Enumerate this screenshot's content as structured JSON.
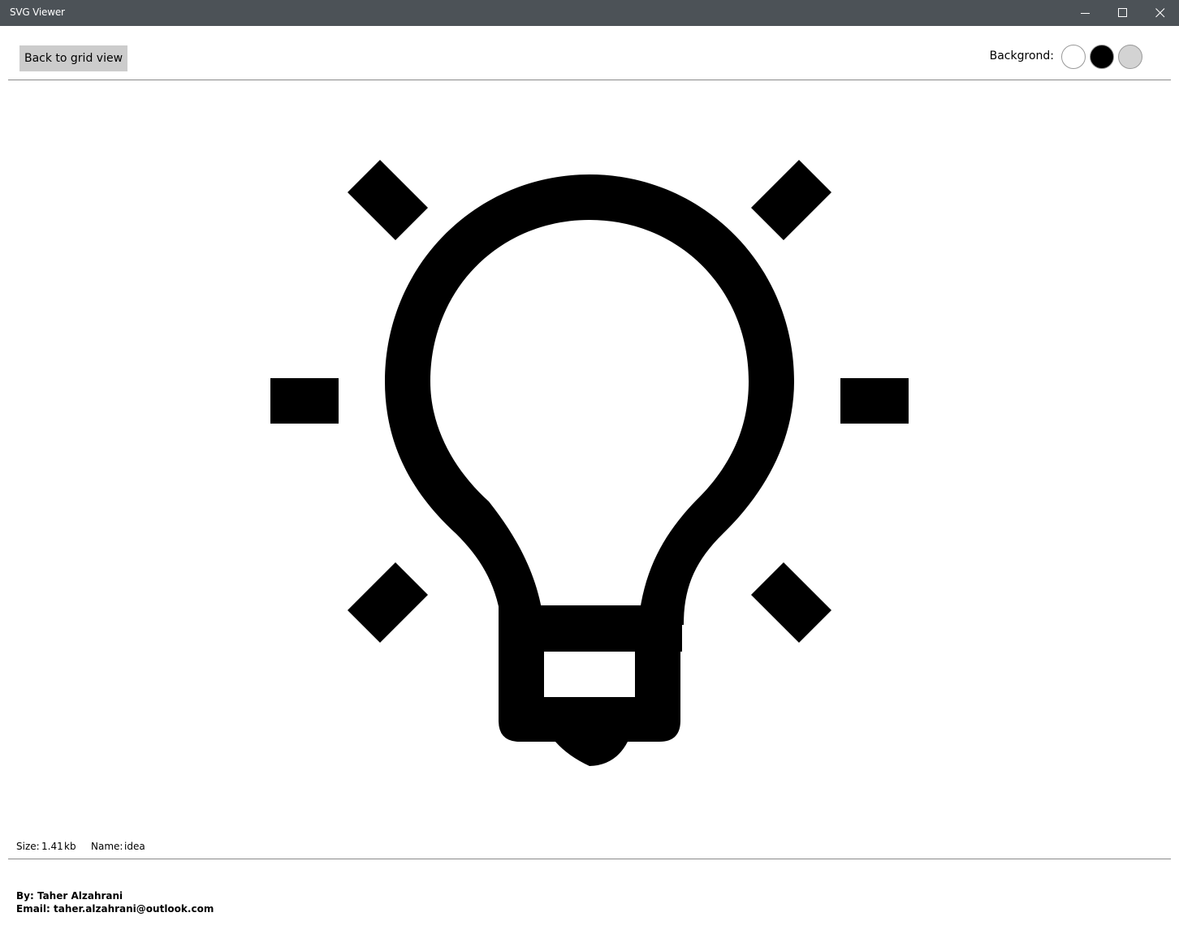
{
  "window": {
    "title": "SVG Viewer",
    "controls": [
      "minimize-icon",
      "maximize-icon",
      "close-icon"
    ]
  },
  "toolbar": {
    "back_label": "Back to grid view",
    "background_label": "Backgrond:",
    "swatches": [
      {
        "name": "white",
        "color": "#ffffff"
      },
      {
        "name": "black",
        "color": "#000000"
      },
      {
        "name": "gray",
        "color": "#d3d3d3"
      }
    ]
  },
  "preview": {
    "icon": "lightbulb-idea-icon",
    "fill_color": "#000000",
    "background_color": "#ffffff"
  },
  "info": {
    "size_label": "Size:",
    "size_value": "1.41",
    "size_unit": "kb",
    "name_label": "Name:",
    "name_value": "idea"
  },
  "footer": {
    "author": "By: Taher Alzahrani",
    "email": "Email: taher.alzahrani@outlook.com"
  }
}
